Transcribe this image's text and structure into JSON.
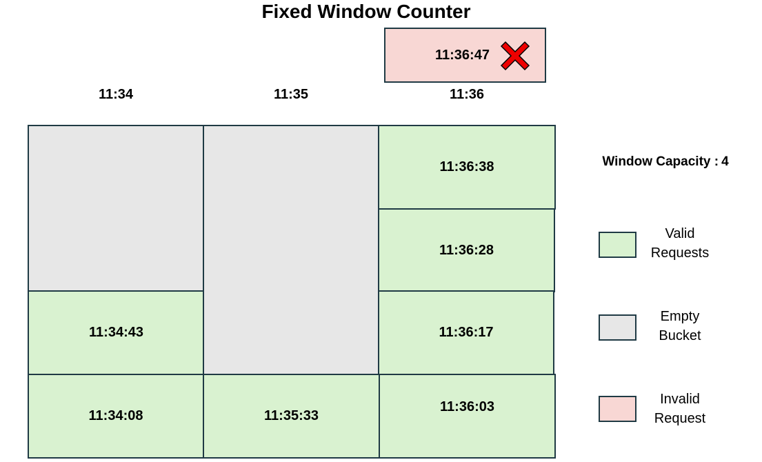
{
  "title": "Fixed Window Counter",
  "columns": [
    {
      "label": "11:34"
    },
    {
      "label": "11:35"
    },
    {
      "label": "11:36"
    }
  ],
  "rejected_request": {
    "time": "11:36:47",
    "icon": "x-mark-icon"
  },
  "window_capacity": {
    "label": "Window Capacity :",
    "value": "4"
  },
  "cells": {
    "col_1134": [
      "11:34:43",
      "11:34:08"
    ],
    "col_1135": [
      "11:35:33"
    ],
    "col_1136": [
      "11:36:38",
      "11:36:28",
      "11:36:17",
      "11:36:03"
    ]
  },
  "legend": [
    {
      "line1": "Valid",
      "line2": "Requests",
      "color": "#d9f2d0"
    },
    {
      "line1": "Empty",
      "line2": "Bucket",
      "color": "#e7e7e7"
    },
    {
      "line1": "Invalid",
      "line2": "Request",
      "color": "#f8d7d4"
    }
  ],
  "colors": {
    "valid": "#d9f2d0",
    "empty": "#e7e7e7",
    "invalid": "#f8d7d4",
    "border": "#1f3a44",
    "reject_mark": "#ee0000"
  }
}
